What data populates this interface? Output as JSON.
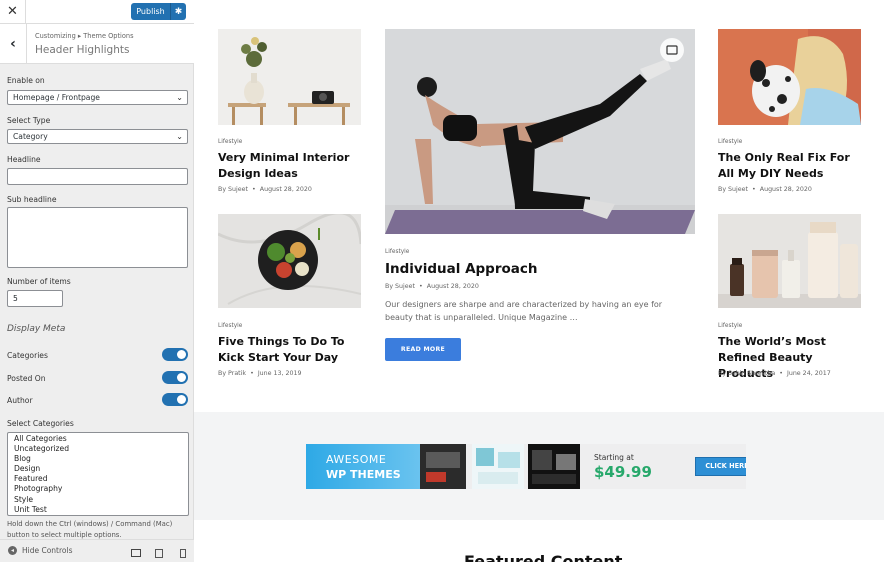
{
  "customizer": {
    "close_glyph": "✕",
    "publish_label": "Publish",
    "breadcrumb": "Customizing ▸ Theme Options",
    "section_title": "Header Highlights",
    "enable_on_label": "Enable on",
    "enable_on_value": "Homepage / Frontpage",
    "select_type_label": "Select Type",
    "select_type_value": "Category",
    "headline_label": "Headline",
    "headline_value": "",
    "subheadline_label": "Sub headline",
    "number_items_label": "Number of items",
    "number_items_value": "5",
    "display_meta_title": "Display Meta",
    "toggles": [
      {
        "label": "Categories",
        "on": true
      },
      {
        "label": "Posted On",
        "on": true
      },
      {
        "label": "Author",
        "on": true
      }
    ],
    "select_categories_label": "Select Categories",
    "categories": [
      "All Categories",
      "Uncategorized",
      "Blog",
      "Design",
      "Featured",
      "Photography",
      "Style",
      "Unit Test"
    ],
    "hint": "Hold down the Ctrl (windows) / Command (Mac) button to select multiple options.",
    "hide_controls_label": "Hide Controls",
    "accent": "#2271b1"
  },
  "posts": {
    "p1": {
      "category": "Lifestyle",
      "title": "Very Minimal Interior Design Ideas",
      "author": "By Sujeet",
      "date": "August 28, 2020"
    },
    "p2": {
      "category": "Lifestyle",
      "title": "Five Things To Do To Kick Start Your Day",
      "author": "By Pratik",
      "date": "June 13, 2019"
    },
    "featured": {
      "category": "Lifestyle",
      "title": "Individual Approach",
      "author": "By Sujeet",
      "date": "August 28, 2020",
      "excerpt": "Our designers are sharpe and are characterized by having an eye for beauty that is unparalleled. Unique Magazine …",
      "button": "READ MORE"
    },
    "p3": {
      "category": "Lifestyle",
      "title": "The Only Real Fix For All My DIY Needs",
      "author": "By Sujeet",
      "date": "August 28, 2020"
    },
    "p4": {
      "category": "Lifestyle",
      "title": "The World’s Most Refined Beauty Products",
      "author": "By Sakin Shrestha",
      "date": "June 24, 2017"
    }
  },
  "banner": {
    "awesome": "AWESOME",
    "wp_themes": "WP THEMES",
    "starting_at": "Starting at",
    "price": "$49.99",
    "button": "CLICK HERE",
    "price_color": "#27a86b"
  },
  "featured_section_title": "Featured Content"
}
